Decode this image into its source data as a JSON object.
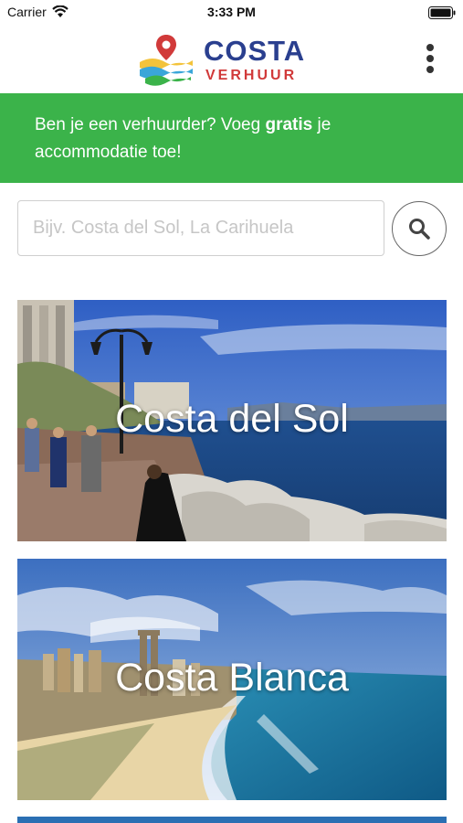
{
  "status_bar": {
    "carrier": "Carrier",
    "time": "3:33 PM"
  },
  "header": {
    "logo_top": "COSTA",
    "logo_bottom": "VERHUUR"
  },
  "banner": {
    "text_before": "Ben je een verhuurder? Voeg ",
    "text_bold": "gratis",
    "text_after": " je accommodatie toe!"
  },
  "search": {
    "placeholder": "Bijv. Costa del Sol, La Carihuela",
    "value": ""
  },
  "destinations": [
    {
      "name": "Costa del Sol"
    },
    {
      "name": "Costa Blanca"
    }
  ],
  "colors": {
    "banner_green": "#3bb34a",
    "logo_blue": "#2a3f8f",
    "logo_red": "#d13a3a"
  }
}
